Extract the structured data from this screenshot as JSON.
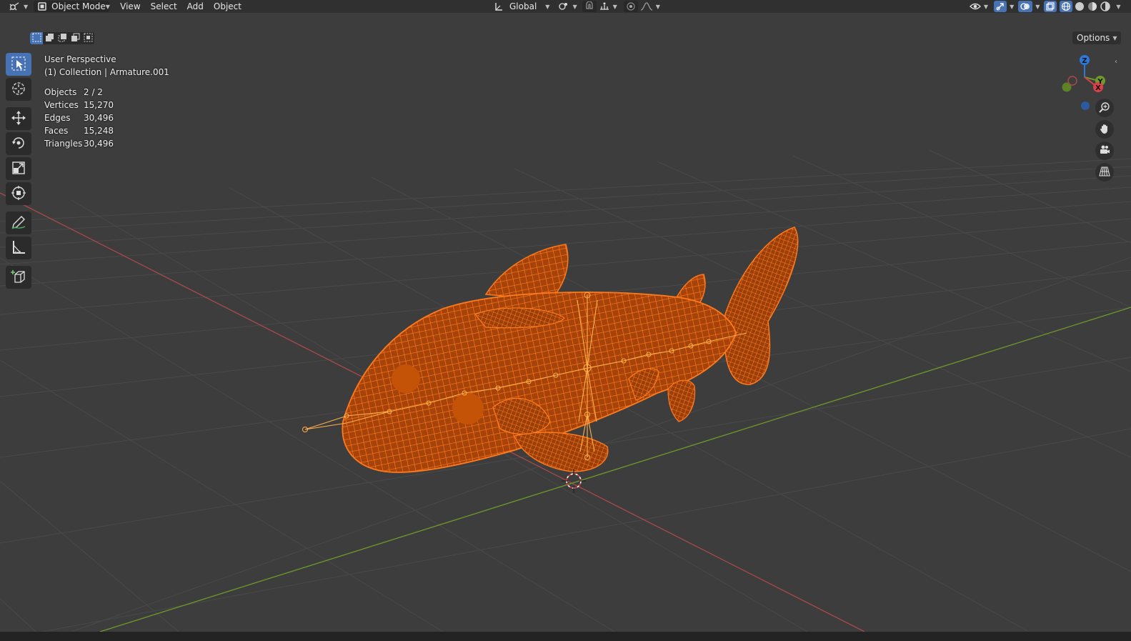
{
  "header": {
    "editor_icon": "3d-viewport-icon",
    "mode_label": "Object Mode",
    "menus": [
      "View",
      "Select",
      "Add",
      "Object"
    ],
    "orientation_label": "Global"
  },
  "viewport": {
    "perspective_label": "User Perspective",
    "collection_label": "(1) Collection | Armature.001",
    "stats": [
      {
        "label": "Objects",
        "value": "2 / 2"
      },
      {
        "label": "Vertices",
        "value": "15,270"
      },
      {
        "label": "Edges",
        "value": "30,496"
      },
      {
        "label": "Faces",
        "value": "15,248"
      },
      {
        "label": "Triangles",
        "value": "30,496"
      }
    ],
    "options_label": "Options",
    "gizmo_axes": [
      "Z",
      "Y",
      "X"
    ]
  },
  "toolbar": {
    "tools": [
      "select-box",
      "cursor",
      "move",
      "rotate",
      "scale",
      "transform",
      "annotate",
      "measure",
      "add-cube"
    ],
    "active_tool": "select-box"
  },
  "colors": {
    "background": "#3d3d3d",
    "header": "#303030",
    "accent": "#4772b3",
    "selection_orange": "#e8650f",
    "x_axis": "#a84a4a",
    "y_axis": "#6f9a2a",
    "z_axis": "#2a79dd"
  }
}
